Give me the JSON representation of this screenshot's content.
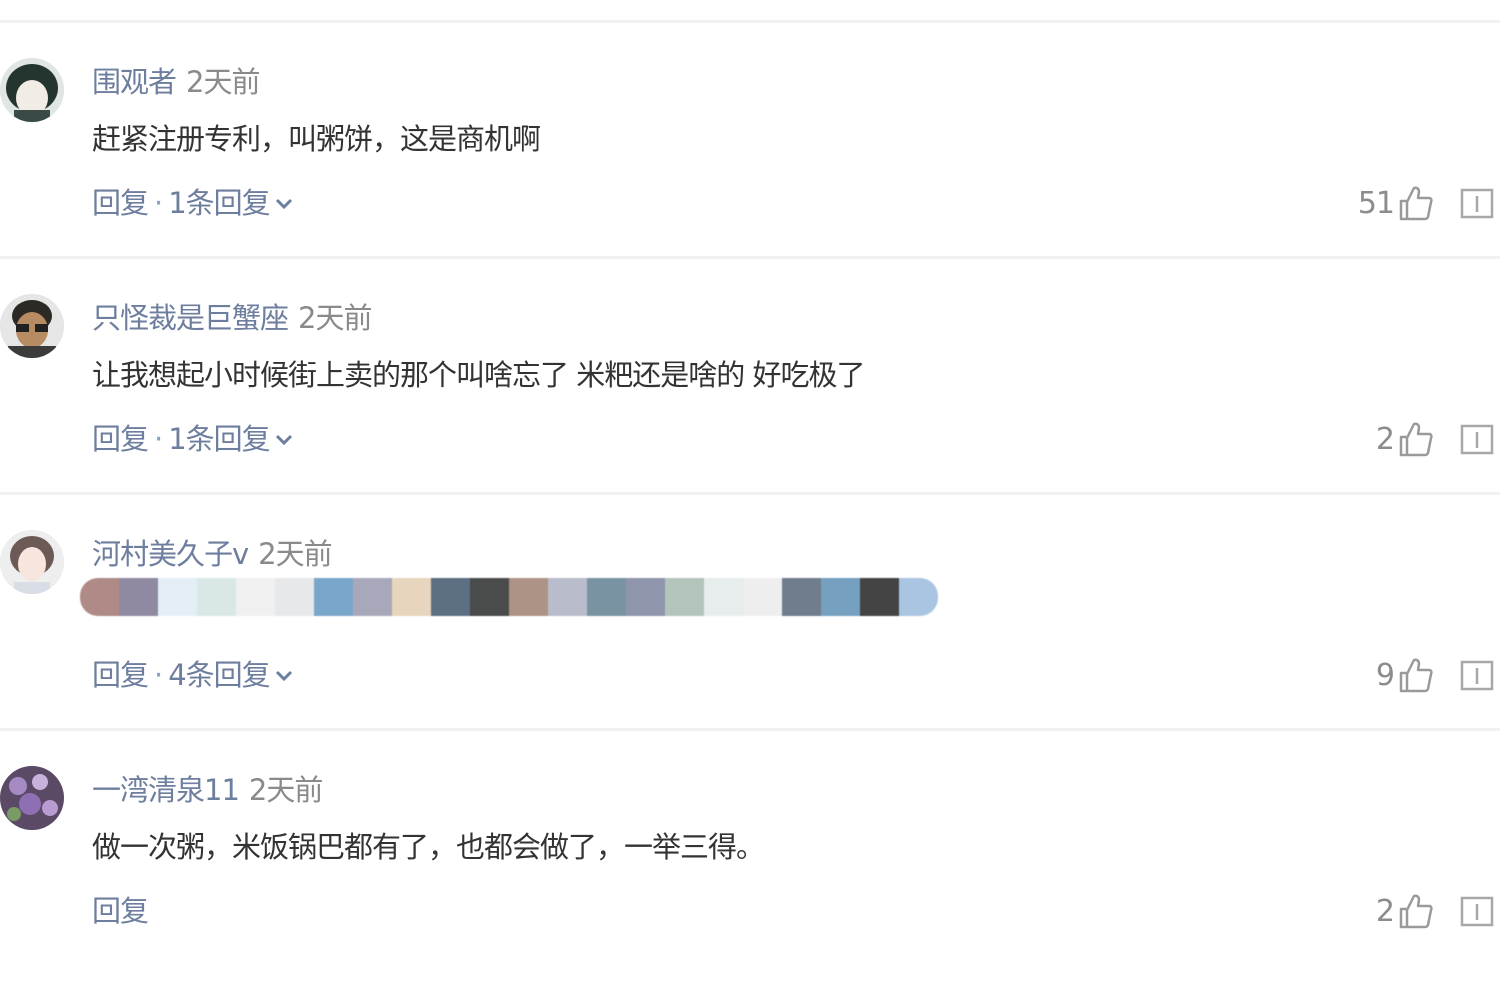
{
  "comments": [
    {
      "username": "围观者",
      "time": "2天前",
      "text": "赶紧注册专利，叫粥饼，这是商机啊",
      "reply_label": "回复",
      "separator": "·",
      "replies_label": "1条回复",
      "likes": "51",
      "avatar_icon": "avatar-dark-hair-icon"
    },
    {
      "username": "只怪裁是巨蟹座",
      "time": "2天前",
      "text": "让我想起小时候街上卖的那个叫啥忘了 米粑还是啥的 好吃极了",
      "reply_label": "回复",
      "separator": "·",
      "replies_label": "1条回复",
      "likes": "2",
      "avatar_icon": "avatar-glasses-icon"
    },
    {
      "username": "河村美久子v",
      "time": "2天前",
      "image_blurred": true,
      "mosaic_colors": [
        "#b08a86",
        "#8f8aa1",
        "#e3eef5",
        "#d9e8e6",
        "#f0f0f0",
        "#e6e8ea",
        "#7ba6cc",
        "#a7a9bb",
        "#e8d5bd",
        "#5d6f82",
        "#4a4b4b",
        "#ad9385",
        "#b8bccb",
        "#7993a2",
        "#8e95ad",
        "#b3c4bb",
        "#e7ecec",
        "#eeeeee",
        "#6f7d8c",
        "#76a0c0",
        "#444444",
        "#a9c5e2"
      ],
      "reply_label": "回复",
      "separator": "·",
      "replies_label": "4条回复",
      "likes": "9",
      "avatar_icon": "avatar-girl-icon"
    },
    {
      "username": "一湾清泉11",
      "time": "2天前",
      "text": "做一次粥，米饭锅巴都有了，也都会做了，一举三得。",
      "reply_label": "回复",
      "likes": "2",
      "avatar_icon": "avatar-flowers-icon"
    }
  ],
  "colors": {
    "username": "#6d7e9e",
    "text": "#333333",
    "muted": "#8a8a8a",
    "divider": "#f1f1f1"
  }
}
